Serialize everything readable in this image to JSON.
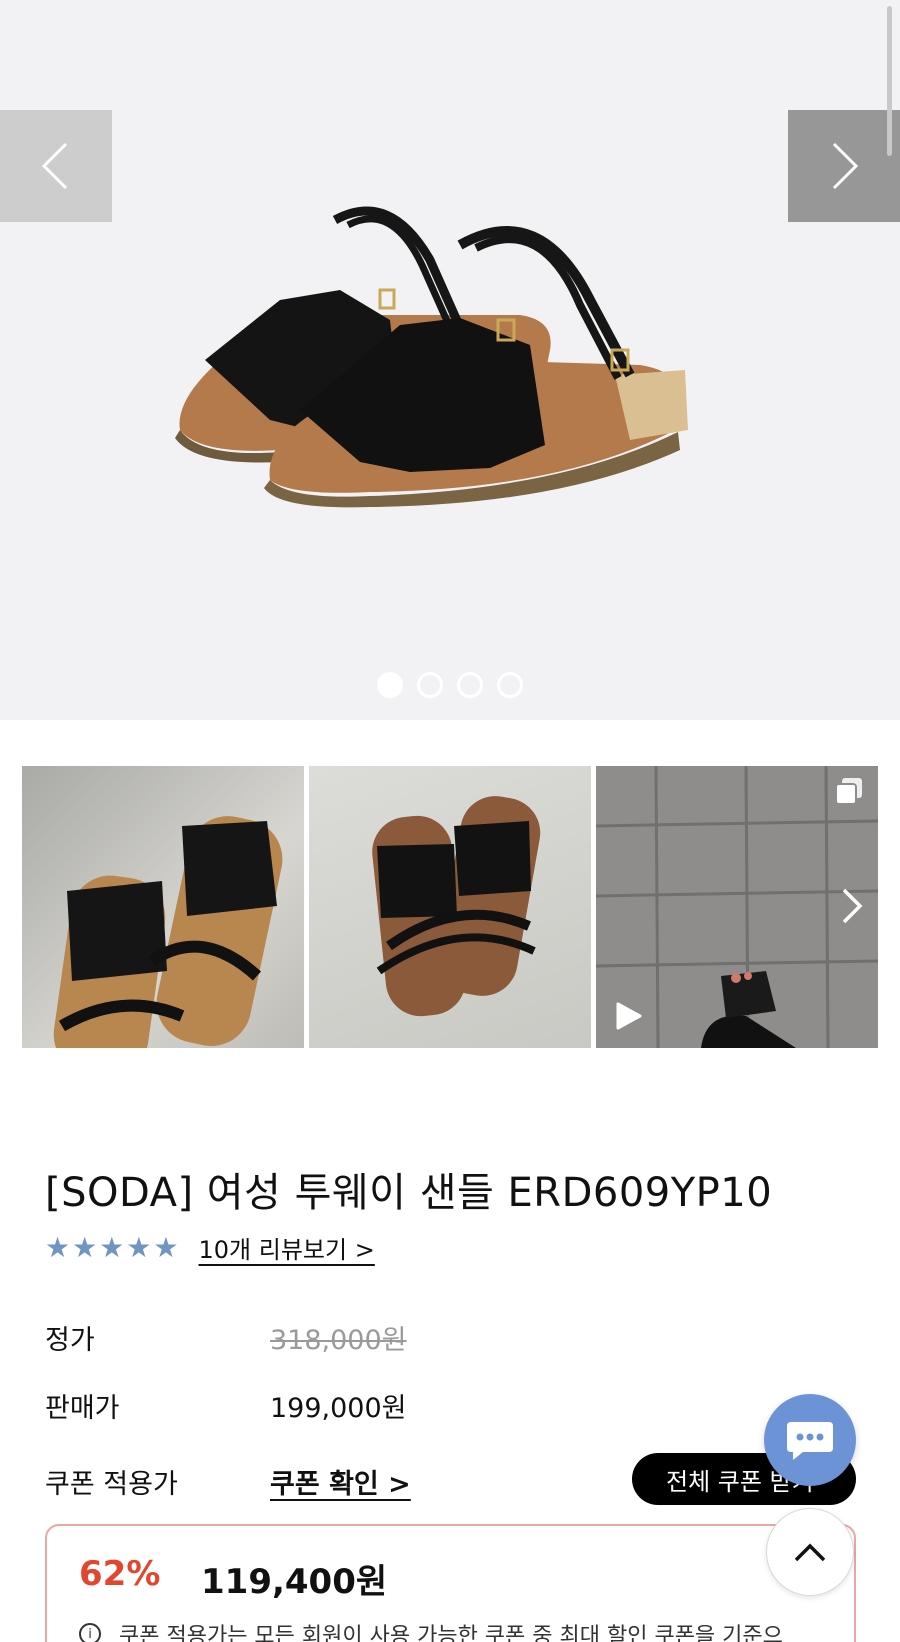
{
  "gallery": {
    "dots": [
      true,
      false,
      false,
      false
    ]
  },
  "product": {
    "title": "[SODA] 여성 투웨이 샌들 ERD609YP10",
    "stars": "★★★★★",
    "review_link": "10개 리뷰보기 >",
    "rating": 5
  },
  "price": {
    "regular_label": "정가",
    "regular_value": "318,000원",
    "sale_label": "판매가",
    "sale_value": "199,000원",
    "coupon_label": "쿠폰 적용가",
    "coupon_link": "쿠폰 확인 >",
    "all_coupon_button": "전체 쿠폰 받기"
  },
  "discount": {
    "percent": "62%",
    "price": "119,400원",
    "info_icon_text": "i",
    "note": "쿠폰 적용가는 모든 회원이 사용 가능한 쿠폰 중 최대 할인 쿠폰을 기준으"
  },
  "colors": {
    "star": "#6f95c4",
    "discount": "#e0472e",
    "chat": "#6b93d6"
  },
  "icons": {
    "prev": "chevron-left-icon",
    "next": "chevron-right-icon",
    "chat": "chat-bubble-icon",
    "top": "chevron-up-icon",
    "play": "play-icon",
    "multi": "multiple-images-icon"
  }
}
